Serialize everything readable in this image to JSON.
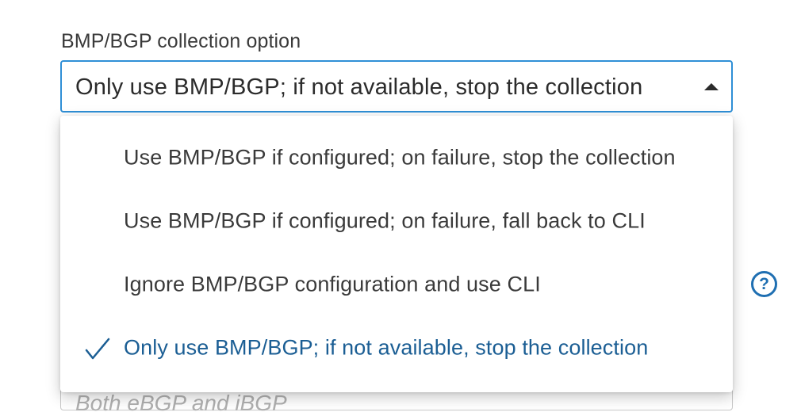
{
  "field": {
    "label": "BMP/BGP collection option",
    "selected_value": "Only use BMP/BGP; if not available, stop the collection",
    "caret_icon": "caret-up-icon"
  },
  "dropdown": {
    "options": [
      {
        "label": "Use BMP/BGP if configured; on failure, stop the collection",
        "selected": false
      },
      {
        "label": "Use BMP/BGP if configured; on failure, fall back to CLI",
        "selected": false
      },
      {
        "label": "Ignore BMP/BGP configuration and use CLI",
        "selected": false
      },
      {
        "label": "Only use BMP/BGP; if not available, stop the collection",
        "selected": true
      }
    ],
    "check_icon": "checkmark-icon"
  },
  "help": {
    "symbol": "?",
    "icon": "help-icon"
  },
  "next_field": {
    "placeholder": "Both eBGP and iBGP"
  },
  "colors": {
    "focus_border": "#2f8fd6",
    "selected_text": "#1b5e94",
    "help_icon": "#1f6fb2"
  }
}
